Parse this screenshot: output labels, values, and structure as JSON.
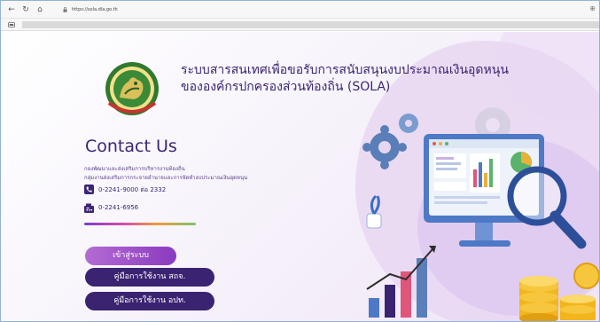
{
  "browser": {
    "url": "https://sola.dla.go.th",
    "back_icon": "arrow-left-icon",
    "reload_icon": "reload-icon",
    "home_icon": "home-icon"
  },
  "page": {
    "title": "ระบบสารสนเทศเพื่อขอรับการสนับสนุนงบประมาณเงินอุดหนุน",
    "title_line2": "ขององค์กรปกครองส่วนท้องถิ่น (SOLA)",
    "contact": {
      "heading": "Contact Us",
      "org_line1": "กองพัฒนาและส่งเสริมการบริหารงานท้องถิ่น",
      "org_line2": "กลุ่มงานส่งเสริมการกระจายอำนาจและการจัดทำงบประมาณเงินอุดหนุน",
      "phone": "0-2241-9000 ต่อ 2332",
      "fax": "0-2241-6956"
    },
    "buttons": {
      "login": "เข้าสู่ระบบ",
      "manual_staff": "คู่มือการใช้งาน สถจ.",
      "manual_local": "คู่มือการใช้งาน อปท."
    }
  },
  "colors": {
    "primary": "#3a2371",
    "accent": "#9b4fc9",
    "background": "#f3ecf8"
  }
}
